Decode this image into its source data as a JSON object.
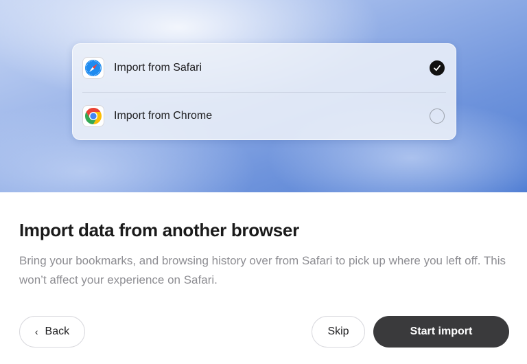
{
  "import_options": [
    {
      "label": "Import from Safari",
      "icon": "safari-icon",
      "selected": true
    },
    {
      "label": "Import from Chrome",
      "icon": "chrome-icon",
      "selected": false
    }
  ],
  "content": {
    "title": "Import data from another browser",
    "description": "Bring your bookmarks, and browsing history over from Safari to pick up where you left off. This won’t affect your experience on Safari."
  },
  "buttons": {
    "back_label": "Back",
    "back_icon": "chevron-left-icon",
    "skip_label": "Skip",
    "start_label": "Start import"
  },
  "colors": {
    "primary_button": "#3a3a3c",
    "selected_check": "#111111",
    "description_text": "#8e8e93"
  }
}
